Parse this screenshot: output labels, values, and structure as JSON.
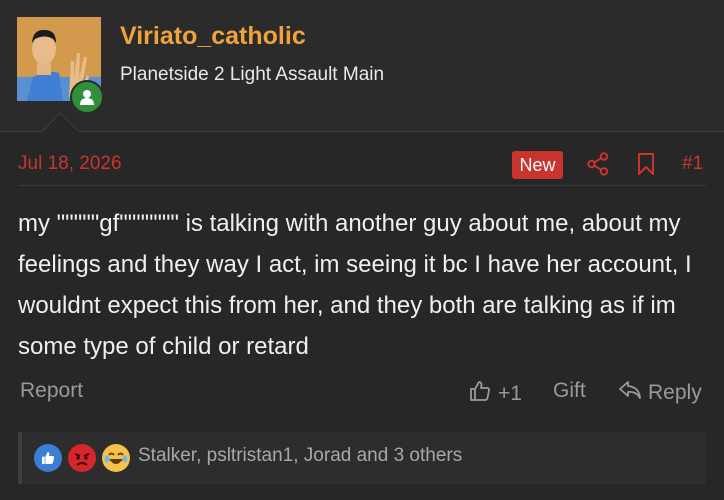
{
  "user": {
    "username": "Viriato_catholic",
    "title": "Planetside 2 Light Assault Main"
  },
  "post": {
    "date": "Jul 18, 2026",
    "badge": "New",
    "number": "#1",
    "body": "my \"\"\"\"\"gf\"\"\"\"\"\"\" is talking with another guy about me, about my feelings and they way I act, im seeing it bc I have her account, I wouldnt expect this from her, and they both are talking as if im some type of child or retard"
  },
  "actions": {
    "report": "Report",
    "like_count": "+1",
    "gift": "Gift",
    "reply": "Reply"
  },
  "reactions": {
    "summary": "Stalker, psltristan1, Jorad and 3 others",
    "icons": [
      "like-icon",
      "angry-icon",
      "laugh-cry-icon"
    ]
  },
  "colors": {
    "accent_red": "#c8352e",
    "username_orange": "#f0a23c",
    "background": "#272727"
  }
}
